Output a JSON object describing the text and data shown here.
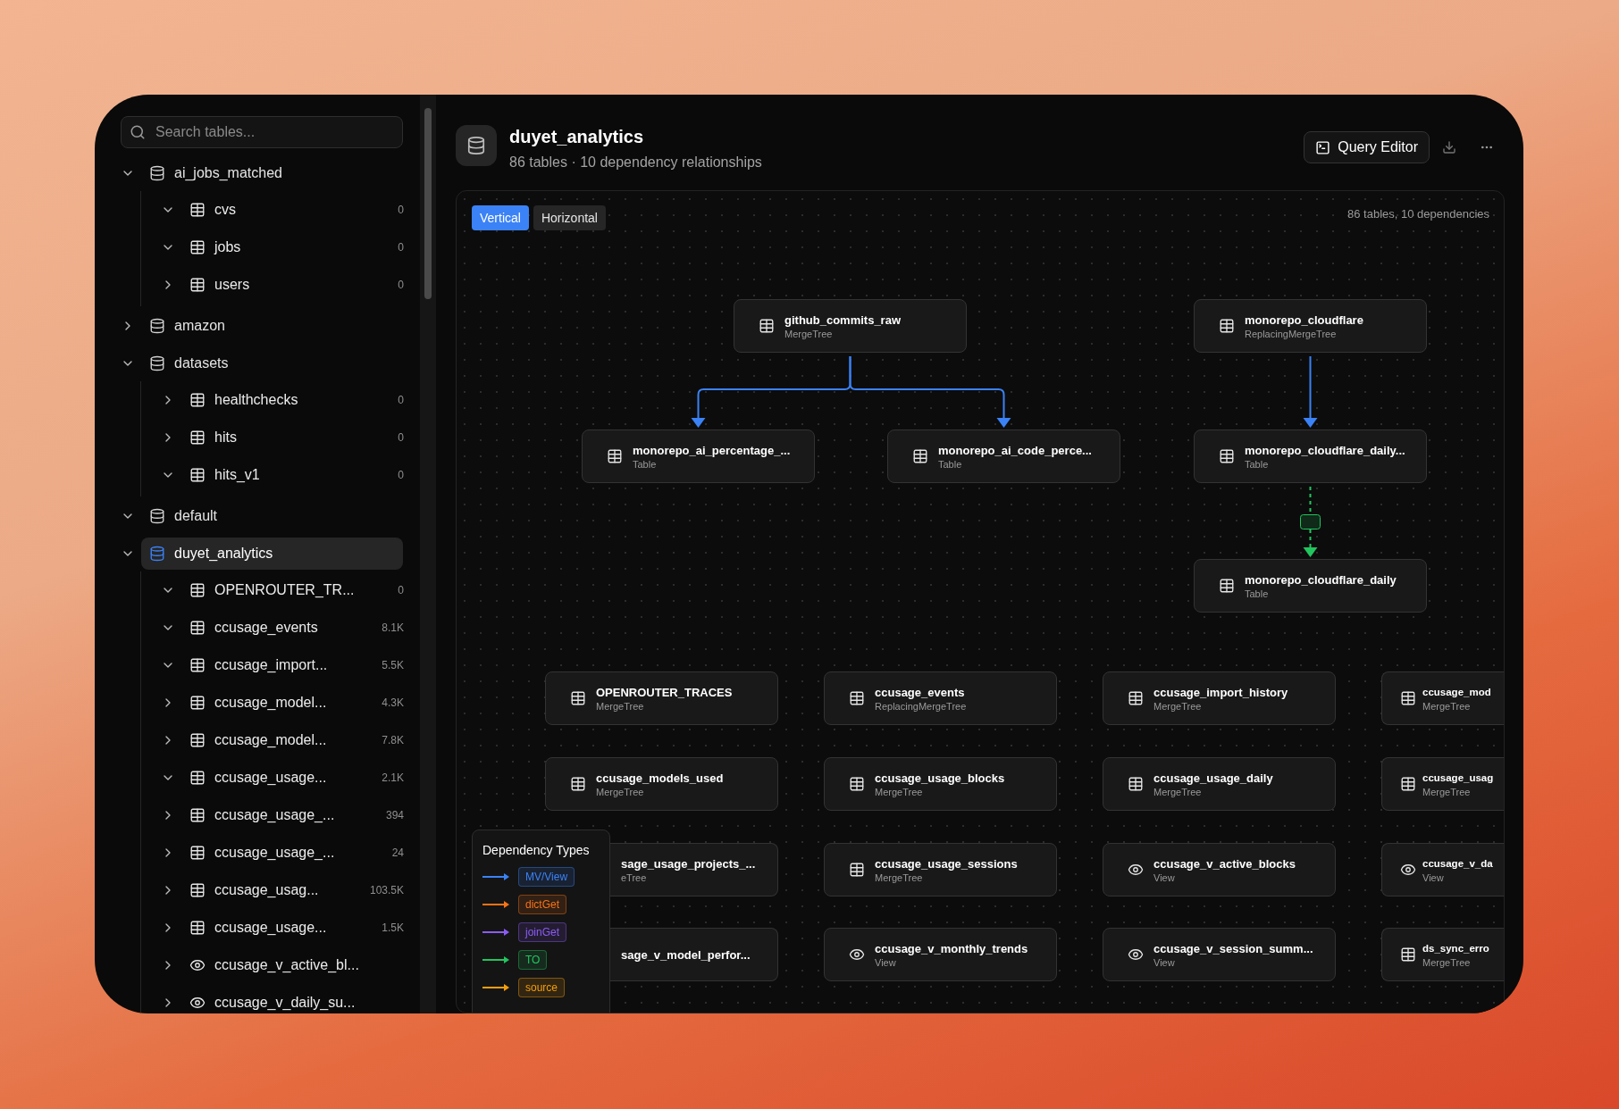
{
  "sidebar": {
    "search": {
      "placeholder": "Search tables..."
    },
    "databases": [
      {
        "name": "ai_jobs_matched",
        "expanded": true,
        "selected": false,
        "children": [
          {
            "name": "cvs",
            "kind": "table",
            "expanded": true,
            "count": "0"
          },
          {
            "name": "jobs",
            "kind": "table",
            "expanded": true,
            "count": "0"
          },
          {
            "name": "users",
            "kind": "table",
            "expanded": false,
            "count": "0"
          }
        ]
      },
      {
        "name": "amazon",
        "expanded": false,
        "selected": false
      },
      {
        "name": "datasets",
        "expanded": true,
        "selected": false,
        "children": [
          {
            "name": "healthchecks",
            "kind": "table",
            "expanded": false,
            "count": "0"
          },
          {
            "name": "hits",
            "kind": "table",
            "expanded": false,
            "count": "0"
          },
          {
            "name": "hits_v1",
            "kind": "table",
            "expanded": true,
            "count": "0"
          }
        ]
      },
      {
        "name": "default",
        "expanded": true,
        "selected": false
      },
      {
        "name": "duyet_analytics",
        "expanded": true,
        "selected": true,
        "children": [
          {
            "name": "OPENROUTER_TR...",
            "kind": "table",
            "expanded": true,
            "count": "0"
          },
          {
            "name": "ccusage_events",
            "kind": "table",
            "expanded": true,
            "count": "8.1K"
          },
          {
            "name": "ccusage_import...",
            "kind": "table",
            "expanded": true,
            "count": "5.5K"
          },
          {
            "name": "ccusage_model...",
            "kind": "table",
            "expanded": false,
            "count": "4.3K"
          },
          {
            "name": "ccusage_model...",
            "kind": "table",
            "expanded": false,
            "count": "7.8K"
          },
          {
            "name": "ccusage_usage...",
            "kind": "table",
            "expanded": true,
            "count": "2.1K"
          },
          {
            "name": "ccusage_usage_...",
            "kind": "table",
            "expanded": false,
            "count": "394"
          },
          {
            "name": "ccusage_usage_...",
            "kind": "table",
            "expanded": false,
            "count": "24"
          },
          {
            "name": "ccusage_usag...",
            "kind": "table",
            "expanded": false,
            "count": "103.5K"
          },
          {
            "name": "ccusage_usage...",
            "kind": "table",
            "expanded": false,
            "count": "1.5K"
          },
          {
            "name": "ccusage_v_active_bl...",
            "kind": "view",
            "expanded": false
          },
          {
            "name": "ccusage_v_daily_su...",
            "kind": "view",
            "expanded": false
          }
        ]
      }
    ]
  },
  "header": {
    "title": "duyet_analytics",
    "subtitle": "86 tables · 10 dependency relationships",
    "button": "Query Editor"
  },
  "canvas": {
    "layouts": [
      {
        "label": "Vertical",
        "selected": true
      },
      {
        "label": "Horizontal",
        "selected": false
      }
    ],
    "summary": "86 tables, 10 dependencies",
    "nodes": [
      {
        "name": "github_commits_raw",
        "engine": "MergeTree",
        "kind": "table"
      },
      {
        "name": "monorepo_cloudflare",
        "engine": "ReplacingMergeTree",
        "kind": "table"
      },
      {
        "name": "monorepo_ai_percentage_...",
        "engine": "Table",
        "kind": "table"
      },
      {
        "name": "monorepo_ai_code_perce...",
        "engine": "Table",
        "kind": "table"
      },
      {
        "name": "monorepo_cloudflare_daily...",
        "engine": "Table",
        "kind": "table"
      },
      {
        "name": "monorepo_cloudflare_daily",
        "engine": "Table",
        "kind": "table"
      },
      {
        "name": "OPENROUTER_TRACES",
        "engine": "MergeTree",
        "kind": "table"
      },
      {
        "name": "ccusage_events",
        "engine": "ReplacingMergeTree",
        "kind": "table"
      },
      {
        "name": "ccusage_import_history",
        "engine": "MergeTree",
        "kind": "table"
      },
      {
        "name": "ccusage_mod",
        "engine": "MergeTree",
        "kind": "table"
      },
      {
        "name": "ccusage_models_used",
        "engine": "MergeTree",
        "kind": "table"
      },
      {
        "name": "ccusage_usage_blocks",
        "engine": "MergeTree",
        "kind": "table"
      },
      {
        "name": "ccusage_usage_daily",
        "engine": "MergeTree",
        "kind": "table"
      },
      {
        "name": "ccusage_usag",
        "engine": "MergeTree",
        "kind": "table"
      },
      {
        "name": "sage_usage_projects_...",
        "engine": "eTree"
      },
      {
        "name": "ccusage_usage_sessions",
        "engine": "MergeTree",
        "kind": "table"
      },
      {
        "name": "ccusage_v_active_blocks",
        "engine": "View",
        "kind": "view"
      },
      {
        "name": "ccusage_v_da",
        "engine": "View",
        "kind": "view"
      },
      {
        "name": "sage_v_model_perfor..."
      },
      {
        "name": "ccusage_v_monthly_trends",
        "engine": "View",
        "kind": "view"
      },
      {
        "name": "ccusage_v_session_summ...",
        "engine": "View",
        "kind": "view"
      },
      {
        "name": "ds_sync_erro",
        "engine": "MergeTree",
        "kind": "table"
      }
    ],
    "legend": {
      "title": "Dependency Types",
      "items": [
        {
          "label": "MV/View",
          "color": "#3b82f6"
        },
        {
          "label": "dictGet",
          "color": "#f97316"
        },
        {
          "label": "joinGet",
          "color": "#8b5cf6"
        },
        {
          "label": "TO",
          "color": "#22c55e"
        },
        {
          "label": "source",
          "color": "#f59e0b"
        }
      ]
    }
  }
}
